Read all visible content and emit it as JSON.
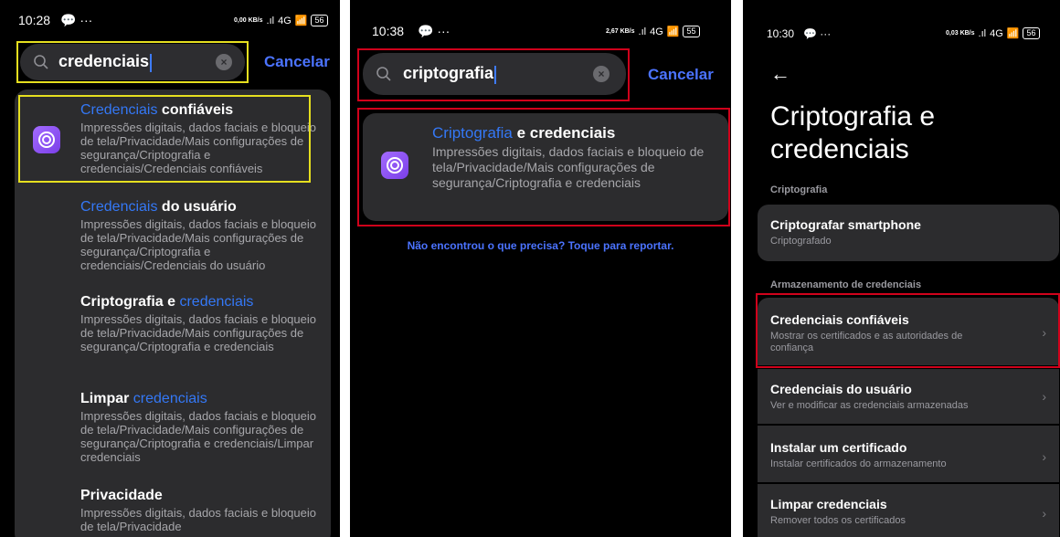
{
  "screen1": {
    "time": "10:28",
    "net_speed": "0,00 KB/s",
    "signal": "4G",
    "battery": "56",
    "query": "credenciais",
    "cancel": "Cancelar",
    "results": [
      {
        "hl": "Credenciais",
        "rest": " confiáveis",
        "path": "Impressões digitais, dados faciais e bloqueio de tela/Privacidade/Mais configurações de segurança/Criptografia e credenciais/Credenciais confiáveis"
      },
      {
        "hl": "Credenciais",
        "rest": " do usuário",
        "path": "Impressões digitais, dados faciais e bloqueio de tela/Privacidade/Mais configurações de segurança/Criptografia e credenciais/Credenciais do usuário"
      },
      {
        "pre": "Criptografia e ",
        "hl": "credenciais",
        "path": "Impressões digitais, dados faciais e bloqueio de tela/Privacidade/Mais configurações de segurança/Criptografia e credenciais"
      },
      {
        "pre": "Limpar ",
        "hl": "credenciais",
        "path": "Impressões digitais, dados faciais e bloqueio de tela/Privacidade/Mais configurações de segurança/Criptografia e credenciais/Limpar credenciais"
      },
      {
        "pre": "Privacidade",
        "path": "Impressões digitais, dados faciais e bloqueio de tela/Privacidade"
      }
    ]
  },
  "screen2": {
    "time": "10:38",
    "net_speed": "2,67 KB/s",
    "signal": "4G",
    "battery": "55",
    "query": "criptografia",
    "cancel": "Cancelar",
    "result": {
      "hl": "Criptografia",
      "rest": " e credenciais",
      "path": "Impressões digitais, dados faciais e bloqueio de tela/Privacidade/Mais configurações de segurança/Criptografia e credenciais"
    },
    "report": "Não encontrou o que precisa? Toque para reportar."
  },
  "screen3": {
    "time": "10:30",
    "net_speed": "0,03 KB/s",
    "signal": "4G",
    "battery": "56",
    "title": "Criptografia e credenciais",
    "section1": "Criptografia",
    "encrypt_title": "Criptografar smartphone",
    "encrypt_sub": "Criptografado",
    "section2": "Armazenamento de credenciais",
    "items": [
      {
        "title": "Credenciais confiáveis",
        "sub": "Mostrar os certificados e as autoridades de confiança"
      },
      {
        "title": "Credenciais do usuário",
        "sub": "Ver e modificar as credenciais armazenadas"
      },
      {
        "title": "Instalar um certificado",
        "sub": "Instalar certificados do armazenamento"
      },
      {
        "title": "Limpar credenciais",
        "sub": "Remover todos os certificados"
      }
    ]
  }
}
